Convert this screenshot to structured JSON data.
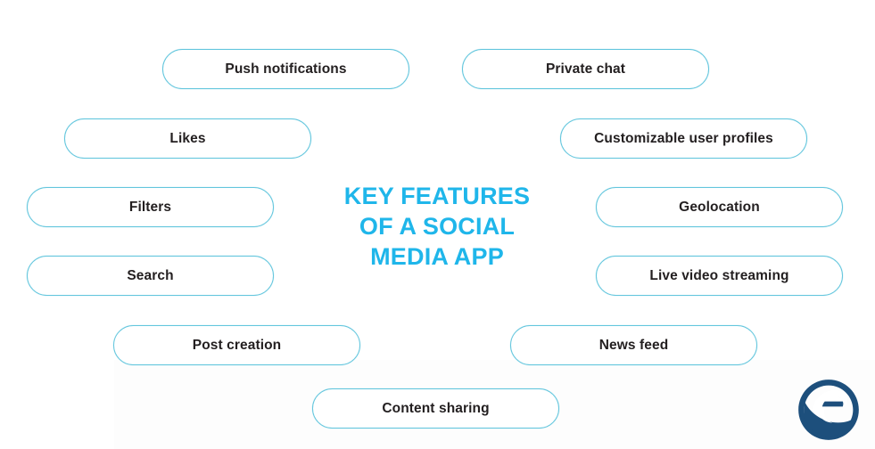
{
  "diagram": {
    "title_lines": [
      "KEY FEATURES",
      "OF A SOCIAL",
      "MEDIA APP"
    ],
    "title_text": "KEY FEATURES OF A SOCIAL MEDIA APP",
    "accent_color": "#1fb6ea",
    "pill_border_color": "#63c6dd",
    "pill_text_color": "#231f20",
    "background_color": "#ffffff",
    "features": [
      {
        "id": "push-notifications",
        "label": "Push notifications",
        "side": "left"
      },
      {
        "id": "private-chat",
        "label": "Private chat",
        "side": "right"
      },
      {
        "id": "likes",
        "label": "Likes",
        "side": "left"
      },
      {
        "id": "customizable-user-profiles",
        "label": "Customizable user profiles",
        "side": "right"
      },
      {
        "id": "filters",
        "label": "Filters",
        "side": "left"
      },
      {
        "id": "geolocation",
        "label": "Geolocation",
        "side": "right"
      },
      {
        "id": "search",
        "label": "Search",
        "side": "left"
      },
      {
        "id": "live-video-streaming",
        "label": "Live video streaming",
        "side": "right"
      },
      {
        "id": "post-creation",
        "label": "Post creation",
        "side": "left"
      },
      {
        "id": "news-feed",
        "label": "News feed",
        "side": "right"
      },
      {
        "id": "content-sharing",
        "label": "Content sharing",
        "side": "center"
      }
    ]
  },
  "logo": {
    "name": "letter-e-logo",
    "color": "#1d4f7c"
  }
}
